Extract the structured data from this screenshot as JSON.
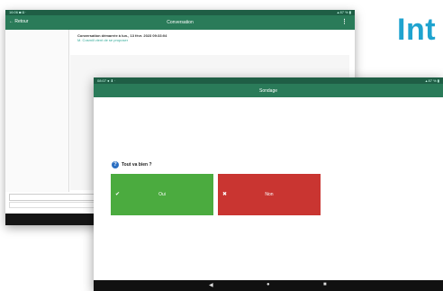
{
  "heading": "Int",
  "back_screen": {
    "status_left": "16:06 ■ ◘ ·",
    "status_right": "▴ 87 % ▮",
    "back_label": "← Retour",
    "title": "Conversation",
    "menu_icon": "kebab-icon",
    "message_title": "Conversation démarrée à lun., 13 févr. 2023 09:33:04",
    "message_sub": "M. Cosmill vient de se proposer"
  },
  "front_screen": {
    "status_left": "08:07 ● ⬇ ·",
    "status_right": "▴ 87 % ▮",
    "title": "Sondage",
    "question": "Tout va bien ?",
    "yes_label": "Oui",
    "no_label": "Non",
    "yes_mark": "✔",
    "no_mark": "✖",
    "nav_back": "◀",
    "nav_home": "●",
    "nav_recent": "■",
    "colors": {
      "appbar": "#2a7b59",
      "yes": "#4bab3f",
      "no": "#c93531",
      "question_icon": "#2b6fc2"
    }
  }
}
